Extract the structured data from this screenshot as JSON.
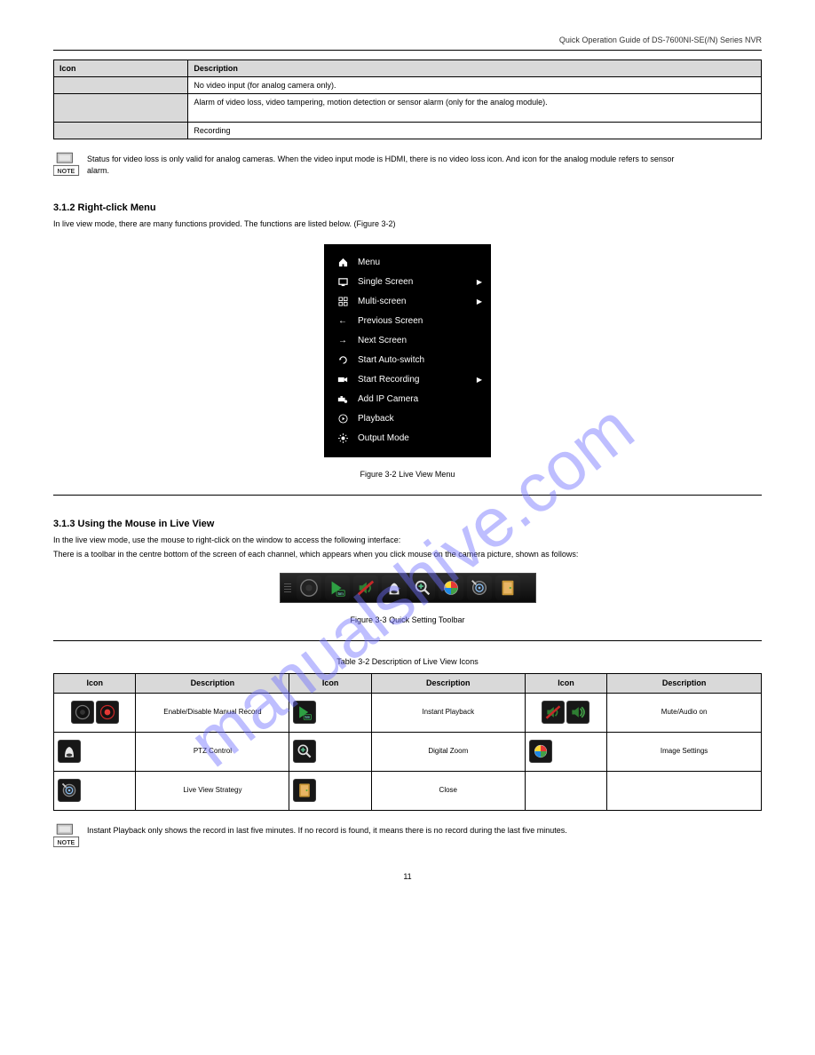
{
  "header": {
    "book_title": "Quick Operation Guide of DS-7600NI-SE(/N) Series NVR"
  },
  "table1": {
    "h1": "Icon",
    "h2": "Description",
    "r1_icon": "...",
    "r1_desc": "No video input (for analog camera only).",
    "r2_icon": "...",
    "r2_desc": "Alarm of video loss, video tampering, motion detection or sensor alarm (only for the analog module).",
    "r3_icon": "...",
    "r3_desc": "Recording",
    "note": "Status for video loss is only valid for analog cameras. When the video input mode is HDMI, there is no video loss icon. And icon for the analog module refers to sensor alarm."
  },
  "section1": {
    "num": "3.1.2",
    "title": "Right-click Menu",
    "para": "In live view mode, there are many functions provided. The functions are listed below. (Figure 3-2)"
  },
  "ctx_menu": {
    "items": [
      {
        "icon": "home",
        "label": "Menu",
        "sub": false
      },
      {
        "icon": "screen",
        "label": "Single Screen",
        "sub": true
      },
      {
        "icon": "multi",
        "label": "Multi-screen",
        "sub": true
      },
      {
        "icon": "prev",
        "label": "Previous Screen",
        "sub": false
      },
      {
        "icon": "next",
        "label": "Next Screen",
        "sub": false
      },
      {
        "icon": "auto",
        "label": "Start Auto-switch",
        "sub": false
      },
      {
        "icon": "rec",
        "label": "Start Recording",
        "sub": true
      },
      {
        "icon": "ipcam",
        "label": "Add IP Camera",
        "sub": false
      },
      {
        "icon": "play",
        "label": "Playback",
        "sub": false
      },
      {
        "icon": "output",
        "label": "Output Mode",
        "sub": false
      }
    ]
  },
  "fig32_caption": "Figure 3-2 Live View Menu",
  "section2": {
    "num": "3.1.3",
    "title": "Using the Mouse in Live View",
    "para1": "In the live view mode, use the mouse to right-click on the window to access the following interface:",
    "para2": "There is a toolbar in the centre bottom of the screen of each channel, which appears when you click mouse on the camera picture, shown as follows:"
  },
  "fig33_caption": "Figure 3-3 Quick Setting Toolbar",
  "table2": {
    "title": "Table 3-2 Description of Live View Icons",
    "headers": [
      "Icon",
      "Description",
      "Icon",
      "Description",
      "Icon",
      "Description"
    ],
    "rows": [
      {
        "d1": "Enable/Disable Manual Record",
        "d2": "Instant Playback",
        "d3": "Mute/Audio on"
      },
      {
        "d1": "PTZ Control",
        "d2": "Digital Zoom",
        "d3": "Image Settings"
      },
      {
        "d1": "Live View Strategy",
        "d2": "Close",
        "d3": ""
      }
    ],
    "note": "Instant Playback only shows the record in last five minutes. If no record is found, it means there is no record during the last five minutes."
  },
  "page_num": "11"
}
